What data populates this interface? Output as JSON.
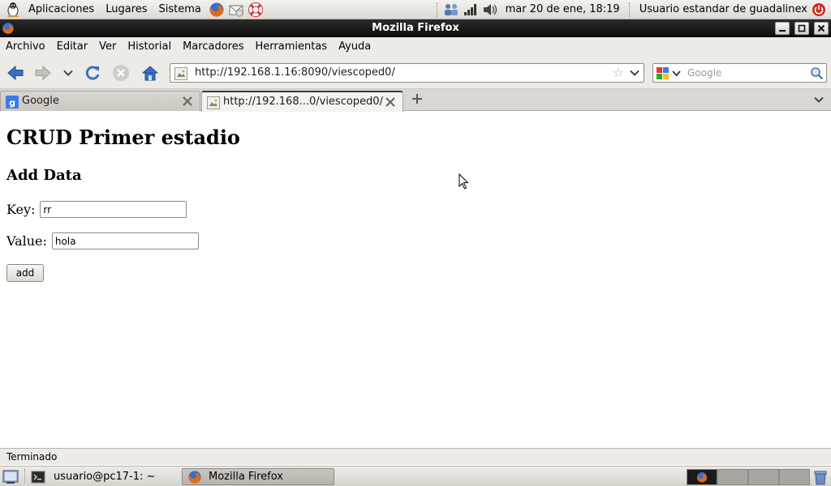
{
  "top_panel": {
    "menus": [
      "Aplicaciones",
      "Lugares",
      "Sistema"
    ],
    "clock": "mar 20 de ene, 18:19",
    "user": "Usuario estandar de guadalinex"
  },
  "window": {
    "title": "Mozilla Firefox"
  },
  "menubar": {
    "items": [
      "Archivo",
      "Editar",
      "Ver",
      "Historial",
      "Marcadores",
      "Herramientas",
      "Ayuda"
    ]
  },
  "navbar": {
    "url": "http://192.168.1.16:8090/viescoped0/",
    "search_placeholder": "Google"
  },
  "tabs": [
    {
      "label": "Google",
      "active": false
    },
    {
      "label": "http://192.168...0/viescoped0/",
      "active": true
    }
  ],
  "page": {
    "heading": "CRUD Primer estadio",
    "subheading": "Add Data",
    "key_label": "Key:",
    "key_value": "rr",
    "value_label": "Value:",
    "value_value": "hola",
    "add_button": "add"
  },
  "statusbar": {
    "text": "Terminado"
  },
  "taskbar": {
    "tasks": [
      {
        "label": "usuario@pc17-1: ~",
        "focused": false
      },
      {
        "label": "Mozilla Firefox",
        "focused": true
      }
    ]
  },
  "colors": {
    "titlebar": "#111111",
    "panel": "#dcdad5",
    "window_bg": "#edebe7",
    "google_blue": "#3b7be8",
    "power_red": "#cc2a1e"
  }
}
